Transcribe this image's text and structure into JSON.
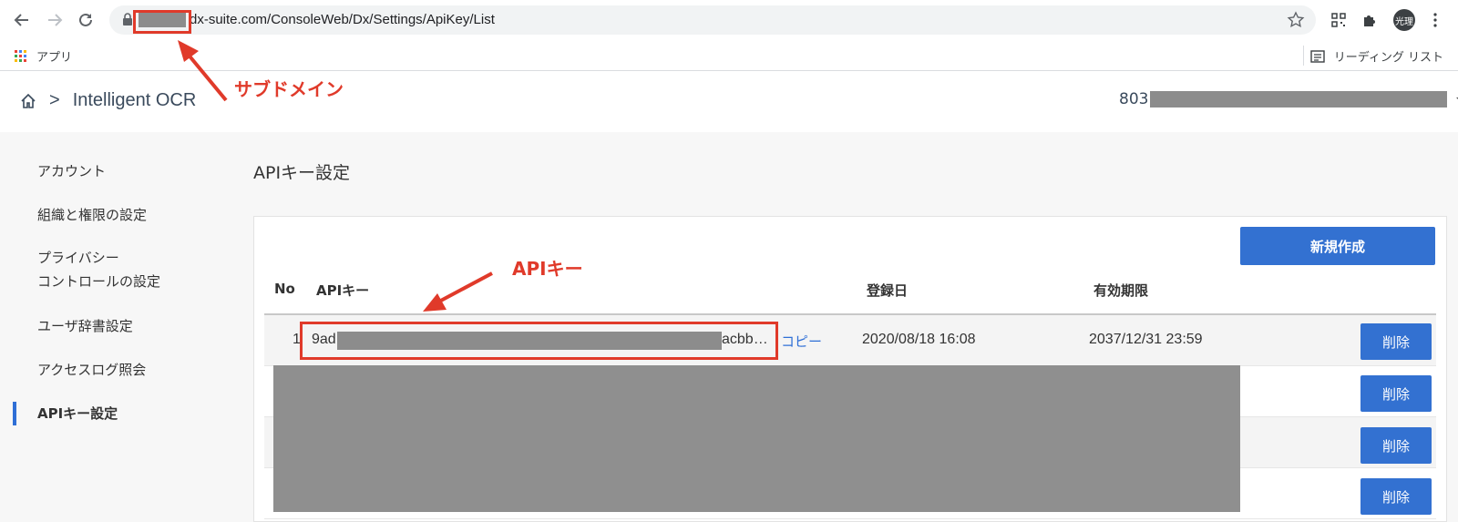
{
  "browser": {
    "url_path": "dx-suite.com/ConsoleWeb/Dx/Settings/ApiKey/List",
    "bookmarks": {
      "apps_label": "アプリ",
      "reading_list_label": "リーディング リスト"
    },
    "profile_initials": "光理"
  },
  "header": {
    "breadcrumb_sep": ">",
    "app_name": "Intelligent OCR",
    "account_prefix": "803"
  },
  "sidebar": {
    "items": [
      {
        "label": "アカウント"
      },
      {
        "label": "組織と権限の設定"
      },
      {
        "label_line1": "プライバシー",
        "label_line2": "コントロールの設定"
      },
      {
        "label": "ユーザ辞書設定"
      },
      {
        "label": "アクセスログ照会"
      },
      {
        "label": "APIキー設定",
        "active": true
      }
    ]
  },
  "main": {
    "title": "APIキー設定",
    "new_button": "新規作成",
    "table": {
      "headers": {
        "no": "No",
        "api_key": "APIキー",
        "registered": "登録日",
        "expires": "有効期限"
      },
      "rows": [
        {
          "no": "1",
          "key_start": "9ad",
          "key_end": "acbb…",
          "copy": "コピー",
          "registered": "2020/08/18 16:08",
          "expires": "2037/12/31 23:59",
          "delete": "削除"
        },
        {
          "delete": "削除"
        },
        {
          "delete": "削除"
        },
        {
          "delete": "削除"
        }
      ]
    }
  },
  "annotations": {
    "subdomain_label": "サブドメイン",
    "apikey_label": "APIキー",
    "color": "#e03a2a"
  },
  "colors": {
    "accent": "#3371d1",
    "link": "#2f6fd6",
    "annotation": "#e03a2a"
  }
}
